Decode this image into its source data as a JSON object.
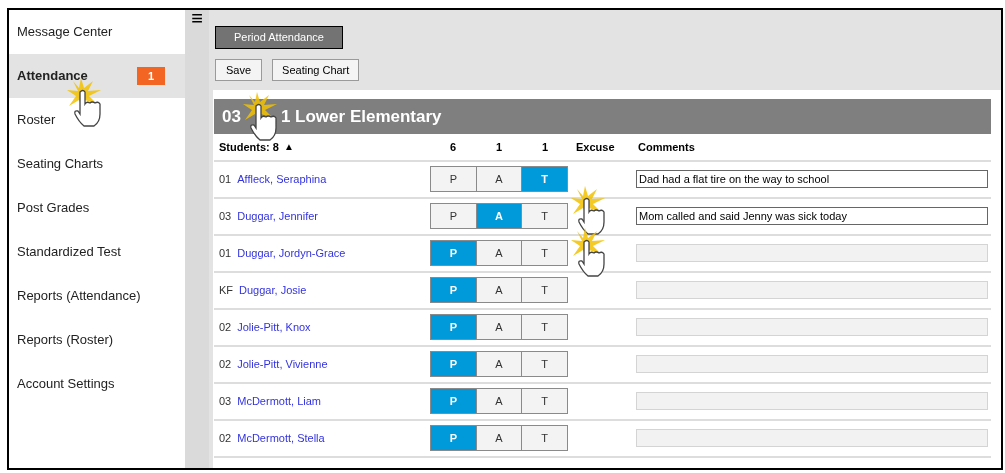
{
  "sidebar": {
    "items": [
      {
        "label": "Message Center",
        "selected": false
      },
      {
        "label": "Attendance",
        "selected": true,
        "badge": "1"
      },
      {
        "label": "Roster",
        "selected": false
      },
      {
        "label": "Seating Charts",
        "selected": false
      },
      {
        "label": "Post Grades",
        "selected": false
      },
      {
        "label": "Standardized Test",
        "selected": false
      },
      {
        "label": "Reports (Attendance)",
        "selected": false
      },
      {
        "label": "Reports (Roster)",
        "selected": false
      },
      {
        "label": "Account Settings",
        "selected": false
      }
    ]
  },
  "menu_icon": "≡",
  "period_button": "Period Attendance",
  "toolbar_buttons": [
    "Save",
    "Seating Chart"
  ],
  "section_title_parts": [
    "03",
    "1 Lower Elementary"
  ],
  "table": {
    "students_header": "Students: 8",
    "sort_icon": "▲",
    "counts": [
      "6",
      "1",
      "1"
    ],
    "excuse_header": "Excuse",
    "comments_header": "Comments",
    "rows": [
      {
        "grade": "01",
        "name": "Affleck, Seraphina",
        "statuses": [
          {
            "label": "P",
            "selected": false
          },
          {
            "label": "A",
            "selected": false
          },
          {
            "label": "T",
            "selected": true
          }
        ],
        "comment": "Dad had a flat tire on the way to school",
        "disabled": false
      },
      {
        "grade": "03",
        "name": "Duggar, Jennifer",
        "statuses": [
          {
            "label": "P",
            "selected": false
          },
          {
            "label": "A",
            "selected": true
          },
          {
            "label": "T",
            "selected": false
          }
        ],
        "comment": "Mom called and said Jenny was sick today",
        "disabled": false
      },
      {
        "grade": "01",
        "name": "Duggar, Jordyn-Grace",
        "statuses": [
          {
            "label": "P",
            "selected": true
          },
          {
            "label": "A",
            "selected": false
          },
          {
            "label": "T",
            "selected": false
          }
        ],
        "disabled": true
      },
      {
        "grade": "KF",
        "name": "Duggar, Josie",
        "statuses": [
          {
            "label": "P",
            "selected": true
          },
          {
            "label": "A",
            "selected": false
          },
          {
            "label": "T",
            "selected": false
          }
        ],
        "disabled": true
      },
      {
        "grade": "02",
        "name": "Jolie-Pitt, Knox",
        "statuses": [
          {
            "label": "P",
            "selected": true
          },
          {
            "label": "A",
            "selected": false
          },
          {
            "label": "T",
            "selected": false
          }
        ],
        "disabled": true
      },
      {
        "grade": "02",
        "name": "Jolie-Pitt, Vivienne",
        "statuses": [
          {
            "label": "P",
            "selected": true
          },
          {
            "label": "A",
            "selected": false
          },
          {
            "label": "T",
            "selected": false
          }
        ],
        "disabled": true
      },
      {
        "grade": "03",
        "name": "McDermott, Liam",
        "statuses": [
          {
            "label": "P",
            "selected": true
          },
          {
            "label": "A",
            "selected": false
          },
          {
            "label": "T",
            "selected": false
          }
        ],
        "disabled": true
      },
      {
        "grade": "02",
        "name": "McDermott, Stella",
        "statuses": [
          {
            "label": "P",
            "selected": true
          },
          {
            "label": "A",
            "selected": false
          },
          {
            "label": "T",
            "selected": false
          }
        ],
        "disabled": true
      }
    ]
  }
}
